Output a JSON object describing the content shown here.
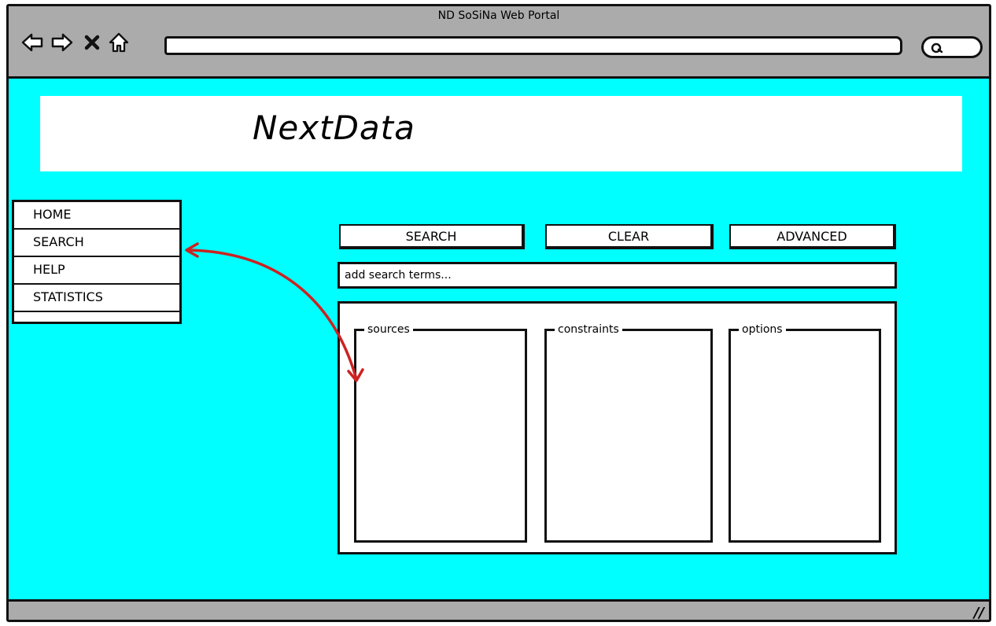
{
  "window": {
    "title": "ND SoSiNa Web Portal"
  },
  "browser": {
    "icons": [
      "back-arrow-icon",
      "forward-arrow-icon",
      "stop-icon",
      "home-icon",
      "search-icon"
    ],
    "url": ""
  },
  "banner": {
    "title": "NextData"
  },
  "menu": {
    "items": [
      {
        "label": "HOME"
      },
      {
        "label": "SEARCH"
      },
      {
        "label": "HELP"
      },
      {
        "label": "STATISTICS"
      }
    ]
  },
  "toolbar": {
    "search_label": "SEARCH",
    "clear_label": "CLEAR",
    "advanced_label": "ADVANCED"
  },
  "search": {
    "placeholder": "add search terms..."
  },
  "groups": {
    "sources": "sources",
    "constraints": "constraints",
    "options": "options"
  },
  "statusbar": {
    "resize_glyph": "//"
  },
  "colors": {
    "content_bg": "#00ffff",
    "chrome_bg": "#ababab",
    "annotation_arrow": "#cc2222"
  }
}
